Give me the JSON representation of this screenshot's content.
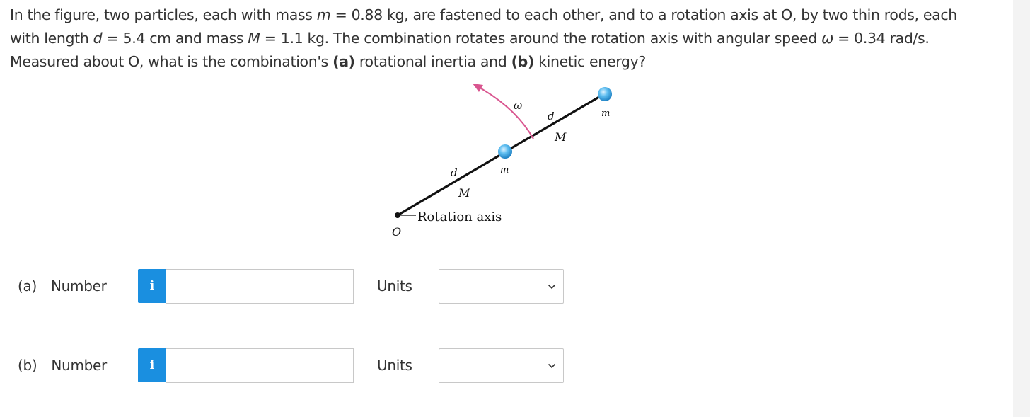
{
  "question": {
    "line1_a": "In the figure, two particles, each with mass ",
    "m_sym": "m",
    "line1_b": " = 0.88 kg, are fastened to each other, and to a rotation axis at O, by two thin rods, each",
    "line2_a": "with length ",
    "d_sym": "d",
    "line2_b": " = 5.4 cm and mass ",
    "M_sym": "M",
    "line2_c": " = 1.1 kg. The combination rotates around the rotation axis with angular speed ",
    "w_sym": "ω",
    "line2_d": " = 0.34 rad/s.",
    "line3_a": "Measured about O, what is the combination's ",
    "part_a_tag": "(a)",
    "line3_b": " rotational inertia and ",
    "part_b_tag": "(b)",
    "line3_c": " kinetic energy?"
  },
  "figure": {
    "omega": "ω",
    "d_outer": "d",
    "M_outer": "M",
    "m_outer": "m",
    "d_inner": "d",
    "M_inner": "M",
    "m_inner": "m",
    "axis_label": "Rotation axis",
    "origin": "O"
  },
  "answers": [
    {
      "part": "(a)",
      "number_label": "Number",
      "info_icon": "i",
      "value": "",
      "units_label": "Units",
      "units_value": ""
    },
    {
      "part": "(b)",
      "number_label": "Number",
      "info_icon": "i",
      "value": "",
      "units_label": "Units",
      "units_value": ""
    }
  ],
  "colors": {
    "info_badge": "#1a8fe0",
    "arc": "#d9558f",
    "particle": "#4fb3e8",
    "text": "#333333"
  }
}
